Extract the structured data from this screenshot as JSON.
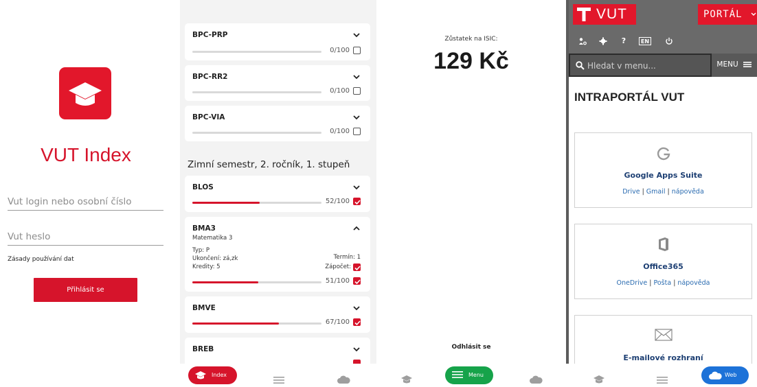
{
  "login": {
    "app_title": "VUT Index",
    "login_placeholder": "Vut login nebo osobní číslo",
    "password_placeholder": "Vut heslo",
    "terms_link": "Zásady používání dat",
    "login_button": "Přihlásit se"
  },
  "courses": {
    "max_score": 100,
    "top_cards": [
      {
        "code": "BPC-PRP",
        "score": 0,
        "score_text": "0/100",
        "checked": false
      },
      {
        "code": "BPC-RR2",
        "score": 0,
        "score_text": "0/100",
        "checked": false
      },
      {
        "code": "BPC-VIA",
        "score": 0,
        "score_text": "0/100",
        "checked": false
      }
    ],
    "section_title": "Zimní semestr, 2. ročník, 1. stupeň",
    "blos": {
      "code": "BLOS",
      "score": 52,
      "score_text": "52/100",
      "checked": true
    },
    "bma3": {
      "code": "BMA3",
      "name": "Matematika 3",
      "type": "Typ: P",
      "completion": "Ukončení: zá,zk",
      "credits": "Kredity: 5",
      "term": "Termín: 1",
      "credit_label": "Zápočet:",
      "score": 51,
      "score_text": "51/100",
      "checked": true
    },
    "bmve": {
      "code": "BMVE",
      "score": 67,
      "score_text": "67/100",
      "checked": true
    },
    "breb": {
      "code": "BREB",
      "checked": true
    }
  },
  "balance": {
    "label": "Zůstatek na ISIC:",
    "value": "129 Kč",
    "logout": "Odhlásit se"
  },
  "portal": {
    "logo_text": "VUT",
    "portal_button": "PORTÁL",
    "tool_en": "EN",
    "search_placeholder": "Hledat v menu...",
    "menu_label": "MENU",
    "title": "INTRAPORTÁL VUT",
    "tiles": [
      {
        "name": "Google Apps Suite",
        "links": [
          "Drive",
          "Gmail",
          "nápověda"
        ],
        "icon": "google-g-icon"
      },
      {
        "name": "Office365",
        "links": [
          "OneDrive",
          "Pošta",
          "nápověda"
        ],
        "icon": "office-icon"
      },
      {
        "name": "E-mailové rozhraní",
        "icon": "envelope-icon"
      }
    ]
  },
  "nav": {
    "index_label": "Index",
    "menu_label": "Menu",
    "web_label": "Web",
    "colors": {
      "index": "#d6142b",
      "menu": "#16a34a",
      "web": "#1d72d8",
      "icon": "#9e9e9e"
    }
  }
}
